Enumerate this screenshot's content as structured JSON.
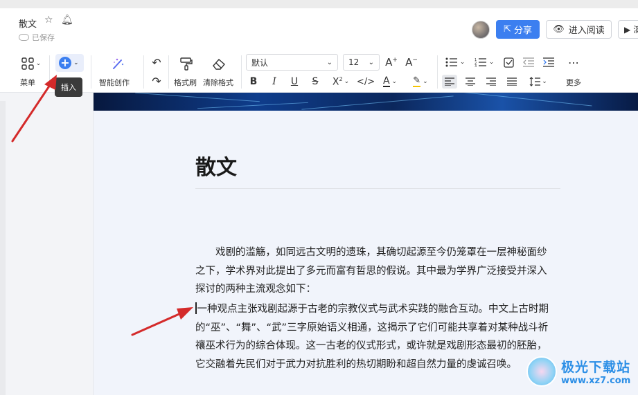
{
  "header": {
    "doc_title": "散文",
    "saved_status": "已保存",
    "share_label": "分享",
    "read_label": "进入阅读",
    "play_label": "演"
  },
  "toolbar": {
    "menu_label": "菜单",
    "insert_tooltip": "插入",
    "ai_label": "智能创作",
    "format_painter_label": "格式刷",
    "clear_format_label": "清除格式",
    "font_family": "默认",
    "font_size": "12",
    "more_label": "更多"
  },
  "document": {
    "title": "散文",
    "paragraph1": "戏剧的滥觞，如同远古文明的遗珠，其确切起源至今仍笼罩在一层神秘面纱之下，学术界对此提出了多元而富有哲思的假说。其中最为学界广泛接受并深入探讨的两种主流观念如下：",
    "paragraph2": "一种观点主张戏剧起源于古老的宗教仪式与武术实践的融合互动。中文上古时期的“巫”、“舞”、“武”三字原始语义相通，这揭示了它们可能共享着对某种战斗祈禳巫术行为的综合体现。这一古老的仪式形式，或许就是戏剧形态最初的胚胎，它交融着先民们对于武力对抗胜利的热切期盼和超自然力量的虔诚召唤。"
  },
  "watermark": {
    "name": "极光下载站",
    "url": "www.xz7.com"
  },
  "colors": {
    "accent": "#3c7ff0",
    "annotation_arrow": "#d42a2a"
  }
}
